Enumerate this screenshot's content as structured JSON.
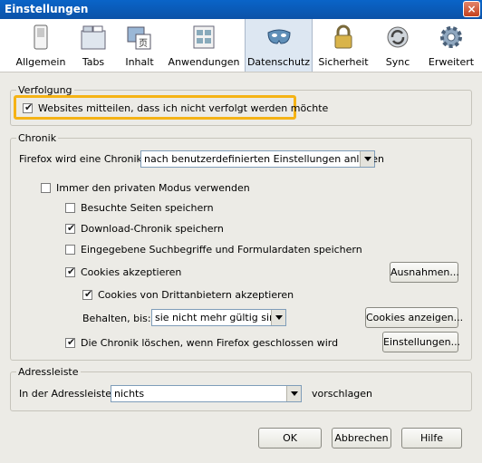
{
  "window": {
    "title": "Einstellungen",
    "close_glyph": "×"
  },
  "toolbar": {
    "items": [
      {
        "label": "Allgemein",
        "icon": "switch-icon"
      },
      {
        "label": "Tabs",
        "icon": "tabs-icon"
      },
      {
        "label": "Inhalt",
        "icon": "content-icon"
      },
      {
        "label": "Anwendungen",
        "icon": "applications-icon"
      },
      {
        "label": "Datenschutz",
        "icon": "privacy-mask-icon",
        "active": true
      },
      {
        "label": "Sicherheit",
        "icon": "padlock-icon"
      },
      {
        "label": "Sync",
        "icon": "sync-icon"
      },
      {
        "label": "Erweitert",
        "icon": "gear-icon"
      }
    ]
  },
  "tracking": {
    "legend": "Verfolgung",
    "dnt_label": "Websites mitteilen, dass ich nicht verfolgt werden möchte",
    "dnt_checked": true,
    "highlight_color": "#f5b315"
  },
  "history": {
    "legend": "Chronik",
    "mode_label": "Firefox wird eine Chronik:",
    "mode_value": "nach benutzerdefinierten Einstellungen anlegen",
    "private_label": "Immer den privaten Modus verwenden",
    "private_checked": false,
    "visited_label": "Besuchte Seiten speichern",
    "visited_checked": false,
    "downloads_label": "Download-Chronik speichern",
    "downloads_checked": true,
    "forms_label": "Eingegebene Suchbegriffe und Formulardaten speichern",
    "forms_checked": false,
    "cookies_label": "Cookies akzeptieren",
    "cookies_checked": true,
    "exceptions_button": "Ausnahmen...",
    "third_party_label": "Cookies von Drittanbietern akzeptieren",
    "third_party_checked": true,
    "keep_label": "Behalten, bis:",
    "keep_value": "sie nicht mehr gültig sind",
    "show_cookies_button": "Cookies anzeigen...",
    "clear_label": "Die Chronik löschen, wenn Firefox geschlossen wird",
    "clear_checked": true,
    "settings_button": "Einstellungen..."
  },
  "location_bar": {
    "legend": "Adressleiste",
    "label": "In der Adressleiste",
    "value": "nichts",
    "suffix": "vorschlagen"
  },
  "footer": {
    "ok": "OK",
    "cancel": "Abbrechen",
    "help": "Hilfe"
  },
  "check_glyph": "✔"
}
